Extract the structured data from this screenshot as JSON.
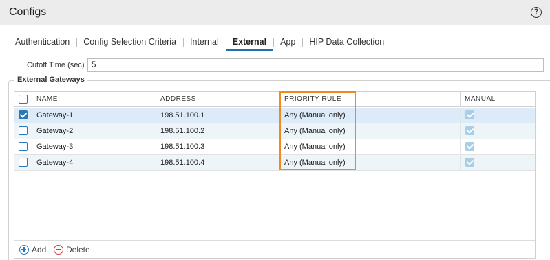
{
  "window": {
    "title": "Configs",
    "help_glyph": "?"
  },
  "tabs": [
    {
      "label": "Authentication",
      "active": false
    },
    {
      "label": "Config Selection Criteria",
      "active": false
    },
    {
      "label": "Internal",
      "active": false
    },
    {
      "label": "External",
      "active": true
    },
    {
      "label": "App",
      "active": false
    },
    {
      "label": "HIP Data Collection",
      "active": false
    }
  ],
  "cutoff": {
    "label": "Cutoff Time (sec)",
    "value": "5"
  },
  "external_gateways": {
    "legend": "External Gateways",
    "columns": [
      "NAME",
      "ADDRESS",
      "PRIORITY RULE",
      "MANUAL"
    ],
    "rows": [
      {
        "selected": true,
        "name": "Gateway-1",
        "address": "198.51.100.1",
        "priority_rule": "Any (Manual only)",
        "manual": true
      },
      {
        "selected": false,
        "name": "Gateway-2",
        "address": "198.51.100.2",
        "priority_rule": "Any (Manual only)",
        "manual": true
      },
      {
        "selected": false,
        "name": "Gateway-3",
        "address": "198.51.100.3",
        "priority_rule": "Any (Manual only)",
        "manual": true
      },
      {
        "selected": false,
        "name": "Gateway-4",
        "address": "198.51.100.4",
        "priority_rule": "Any (Manual only)",
        "manual": true
      }
    ],
    "actions": {
      "add_label": "Add",
      "delete_label": "Delete"
    }
  },
  "colors": {
    "accent": "#2a78b8",
    "highlight": "#f0891e",
    "selected_row": "#dcebf7",
    "delete": "#d23a3a"
  }
}
